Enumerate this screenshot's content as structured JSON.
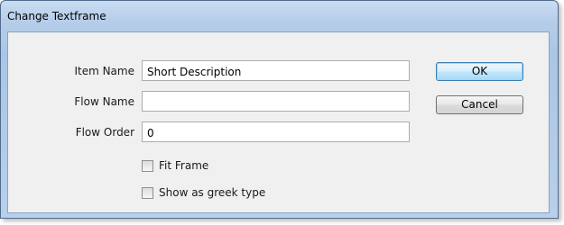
{
  "window": {
    "title": "Change Textframe"
  },
  "form": {
    "item_name": {
      "label": "Item Name",
      "value": "Short Description"
    },
    "flow_name": {
      "label": "Flow Name",
      "value": ""
    },
    "flow_order": {
      "label": "Flow Order",
      "value": "0"
    },
    "fit_frame": {
      "label": "Fit Frame",
      "checked": false
    },
    "show_greek": {
      "label": "Show as greek type",
      "checked": false
    }
  },
  "buttons": {
    "ok": "OK",
    "cancel": "Cancel"
  }
}
